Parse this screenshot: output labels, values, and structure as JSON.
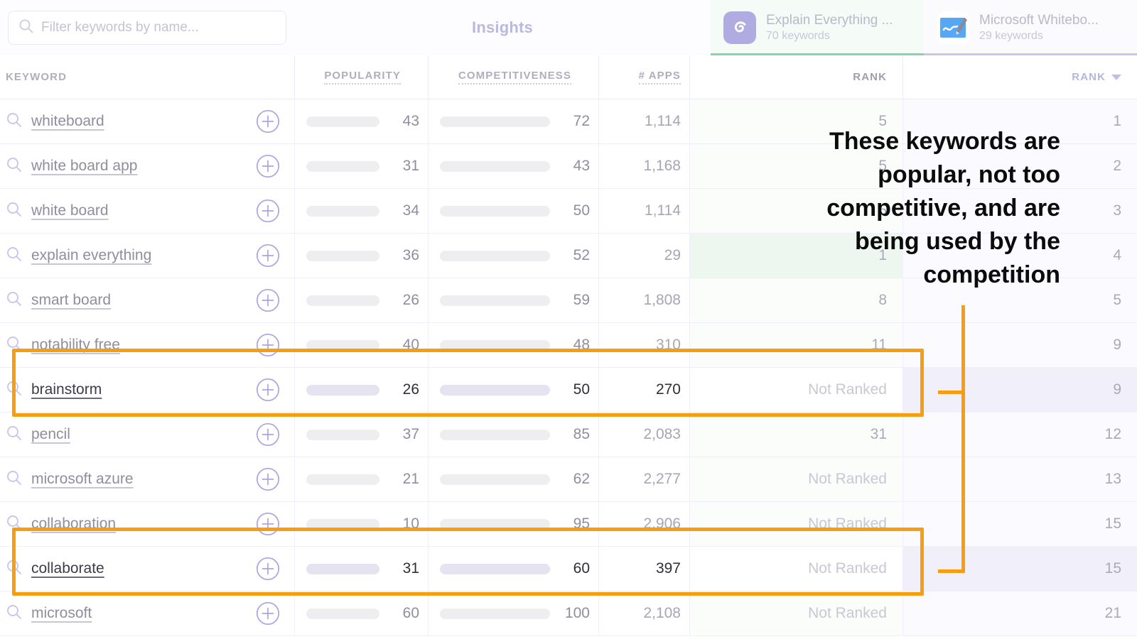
{
  "search": {
    "placeholder": "Filter keywords by name...",
    "value": "",
    "icon": "search-icon"
  },
  "header": {
    "insights_title": "Insights",
    "tabs": [
      {
        "name": "Explain Everything ...",
        "keywords": "70 keywords",
        "icon": "explain-everything-app-icon",
        "accent": "#86d5a4",
        "active": true
      },
      {
        "name": "Microsoft Whitebo...",
        "keywords": "29 keywords",
        "icon": "microsoft-whiteboard-app-icon",
        "accent": "#c9c6ea",
        "active": false
      }
    ]
  },
  "columns": {
    "keyword": "KEYWORD",
    "popularity": "POPULARITY",
    "competitiveness": "COMPETITIVENESS",
    "apps": "# APPS",
    "rank1": "RANK",
    "rank2": "RANK"
  },
  "annotation": {
    "text": "These keywords are popular, not too competitive, and are being used by the competition",
    "color": "#f99d10"
  },
  "chart_data": {
    "type": "table",
    "title": "Insights — keyword metrics",
    "columns": [
      "KEYWORD",
      "POPULARITY",
      "COMPETITIVENESS",
      "# APPS",
      "RANK (Explain Everything)",
      "RANK (Microsoft Whiteboard)"
    ],
    "rows": [
      {
        "keyword": "whiteboard",
        "popularity": 43,
        "competitiveness": 72,
        "apps": "1,114",
        "rank1": "5",
        "rank2": "1",
        "highlighted": false,
        "tinted": false
      },
      {
        "keyword": "white board app",
        "popularity": 31,
        "competitiveness": 43,
        "apps": "1,168",
        "rank1": "5",
        "rank2": "2",
        "highlighted": false,
        "tinted": false
      },
      {
        "keyword": "white board",
        "popularity": 34,
        "competitiveness": 50,
        "apps": "1,114",
        "rank1": "5",
        "rank2": "3",
        "highlighted": false,
        "tinted": false
      },
      {
        "keyword": "explain everything",
        "popularity": 36,
        "competitiveness": 52,
        "apps": "29",
        "rank1": "1",
        "rank2": "4",
        "highlighted": false,
        "tinted": true
      },
      {
        "keyword": "smart board",
        "popularity": 26,
        "competitiveness": 59,
        "apps": "1,808",
        "rank1": "8",
        "rank2": "5",
        "highlighted": false,
        "tinted": false
      },
      {
        "keyword": "notability free",
        "popularity": 40,
        "competitiveness": 48,
        "apps": "310",
        "rank1": "11",
        "rank2": "9",
        "highlighted": false,
        "tinted": false
      },
      {
        "keyword": "brainstorm",
        "popularity": 26,
        "competitiveness": 50,
        "apps": "270",
        "rank1": "Not Ranked",
        "rank2": "9",
        "highlighted": true,
        "tinted": false
      },
      {
        "keyword": "pencil",
        "popularity": 37,
        "competitiveness": 85,
        "apps": "2,083",
        "rank1": "31",
        "rank2": "12",
        "highlighted": false,
        "tinted": false
      },
      {
        "keyword": "microsoft azure",
        "popularity": 21,
        "competitiveness": 62,
        "apps": "2,277",
        "rank1": "Not Ranked",
        "rank2": "13",
        "highlighted": false,
        "tinted": false
      },
      {
        "keyword": "collaboration",
        "popularity": 10,
        "competitiveness": 95,
        "apps": "2,906",
        "rank1": "Not Ranked",
        "rank2": "15",
        "highlighted": false,
        "tinted": false
      },
      {
        "keyword": "collaborate",
        "popularity": 31,
        "competitiveness": 60,
        "apps": "397",
        "rank1": "Not Ranked",
        "rank2": "15",
        "highlighted": true,
        "tinted": false
      },
      {
        "keyword": "microsoft",
        "popularity": 60,
        "competitiveness": 100,
        "apps": "2,108",
        "rank1": "Not Ranked",
        "rank2": "21",
        "highlighted": false,
        "tinted": false
      }
    ],
    "popularity_range": [
      0,
      100
    ],
    "competitiveness_range": [
      0,
      100
    ],
    "bar_color": "#b9b7e6",
    "bar_color_highlighted": "#6f6ac9",
    "track_color": "#eeeef1"
  }
}
